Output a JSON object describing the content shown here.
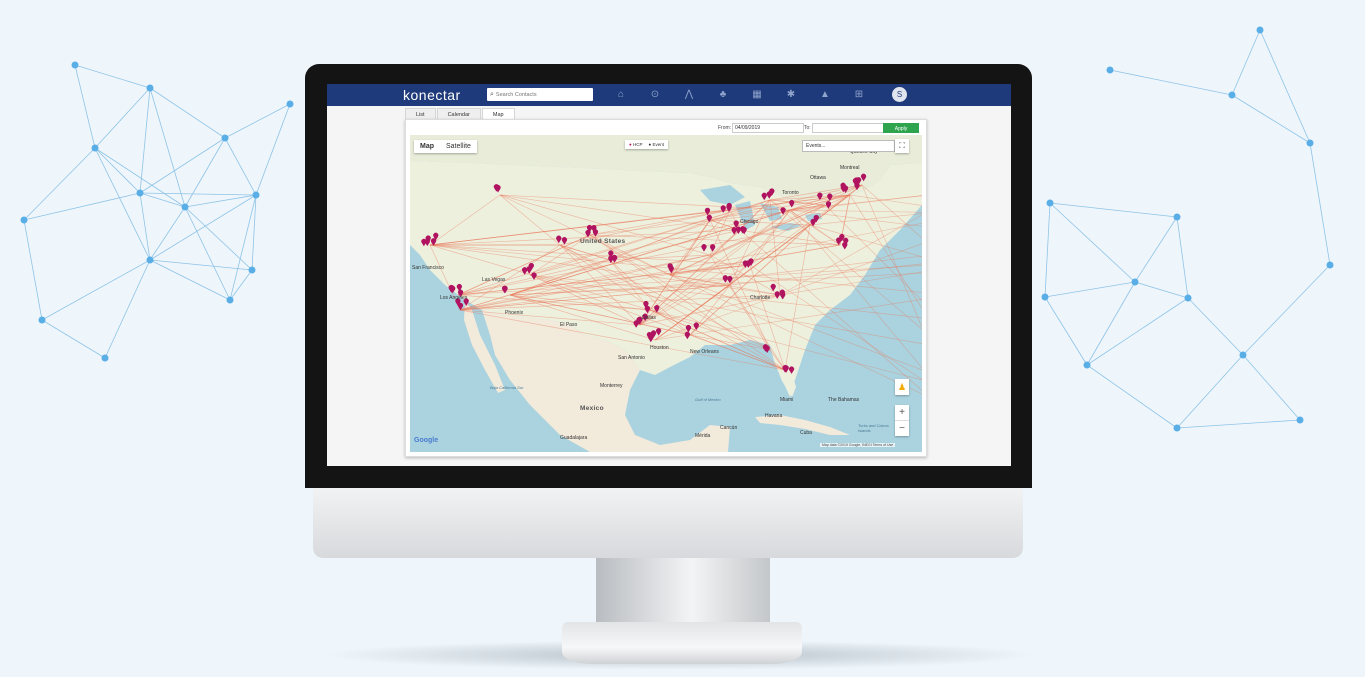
{
  "app": {
    "logo": "konectar"
  },
  "search": {
    "placeholder": "Search Contacts"
  },
  "nav": {
    "icons": [
      "home-icon",
      "search-icon",
      "network-icon",
      "tree-icon",
      "calendar-icon",
      "settings-icon",
      "buildings-icon",
      "hierarchy-icon"
    ],
    "avatar_initial": "S"
  },
  "tabs": [
    {
      "label": "List"
    },
    {
      "label": "Calendar"
    },
    {
      "label": "Map",
      "active": true
    }
  ],
  "filters": {
    "from_label": "From:",
    "from_value": "04/09/2019",
    "to_label": "To:",
    "to_value": "",
    "apply_label": "Apply"
  },
  "map": {
    "type_map": "Map",
    "type_satellite": "Satellite",
    "legend_hcp": "HCP",
    "legend_event": "Event",
    "events_select": "Events...",
    "google": "Google",
    "attribution": "Map data ©2019 Google, INEGI  Terms of Use",
    "labels": {
      "us": "United States",
      "mexico": "Mexico",
      "quebec": "Québec City",
      "montreal": "Montreal",
      "ottawa": "Ottawa",
      "toronto": "Toronto",
      "chicago": "Chicago",
      "sf": "San Francisco",
      "lv": "Las Vegas",
      "la": "Los Angeles",
      "phoenix": "Phoenix",
      "elpaso": "El Paso",
      "sanantonio": "San Antonio",
      "houston": "Houston",
      "dallas": "Dallas",
      "neworleans": "New Orleans",
      "charlotte": "Charlotte",
      "miami": "Miami",
      "monterrey": "Monterrey",
      "guadalajara": "Guadalajara",
      "havana": "Havana",
      "cuba": "Cuba",
      "bahamas": "The Bahamas",
      "gulf": "Gulf of Mexico",
      "baja": "Baja California Sur",
      "cancun": "Cancún",
      "merida": "Mérida",
      "turks": "Turks and Caicos Islands"
    }
  },
  "colors": {
    "nav": "#1e3a7a",
    "apply": "#2ea44f",
    "marker": "#b0135f",
    "route": "#e8785a"
  }
}
